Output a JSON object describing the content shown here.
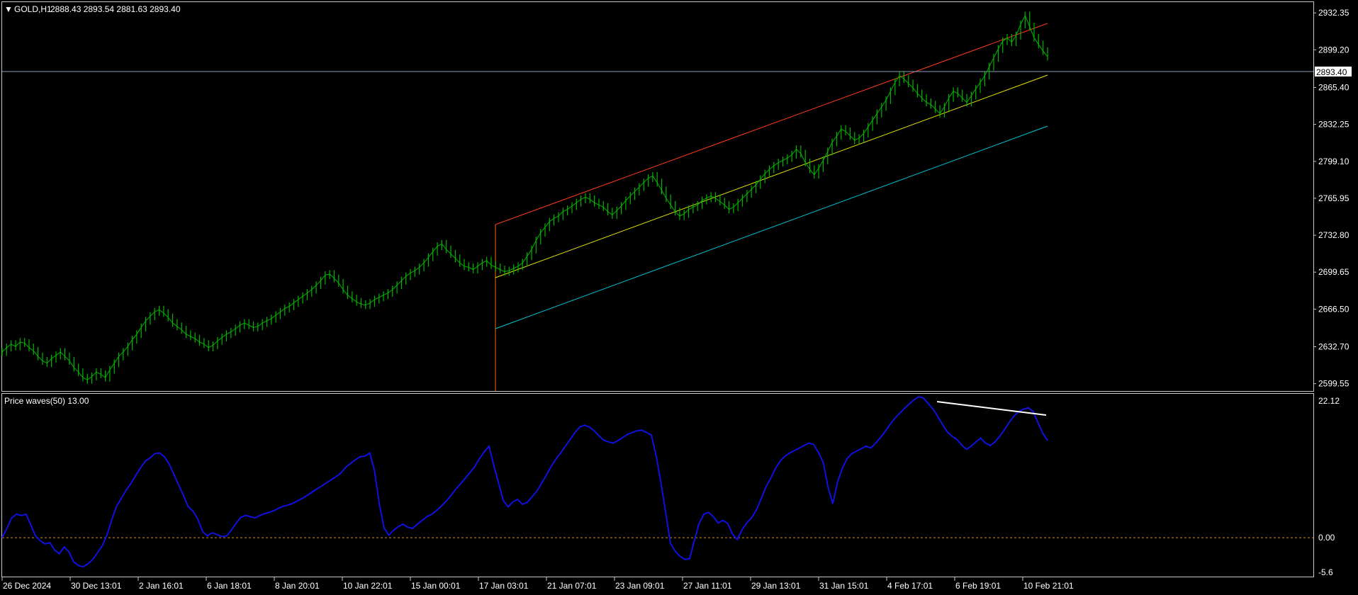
{
  "window": {
    "symbol_label": "GOLD,H1",
    "ohlc": "2888.43 2893.54 2881.63 2893.40",
    "indicator_label": "Price waves(50) 13.00"
  },
  "price_axis": {
    "ticks": [
      "2932.35",
      "2899.20",
      "2865.40",
      "2832.25",
      "2799.10",
      "2765.95",
      "2732.80",
      "2699.65",
      "2666.50",
      "2632.70",
      "2599.55"
    ],
    "current_price": "2893.40"
  },
  "indicator_axis": {
    "ticks": [
      "22.12",
      "0.00",
      "-5.6"
    ]
  },
  "time_axis": {
    "ticks": [
      "26 Dec 2024",
      "30 Dec 13:01",
      "2 Jan 16:01",
      "6 Jan 18:01",
      "8 Jan 20:01",
      "10 Jan 22:01",
      "15 Jan 00:01",
      "17 Jan 03:01",
      "21 Jan 07:01",
      "23 Jan 09:01",
      "27 Jan 11:01",
      "29 Jan 13:01",
      "31 Jan 15:01",
      "4 Feb 17:01",
      "6 Feb 19:01",
      "10 Feb 21:01"
    ]
  },
  "colors": {
    "background": "#000000",
    "border": "#c8c8c8",
    "price_series": "#00b400",
    "indicator_series": "#1010e0",
    "channel_upper": "#ff3a1a",
    "channel_middle": "#e8e800",
    "channel_lower": "#00c8d8",
    "channel_start_line": "#ff6a00",
    "current_price_line": "#8ca0b8",
    "zero_line": "#d89020",
    "divergence_line": "#ffffff"
  },
  "chart_data": [
    {
      "type": "line",
      "series": [
        {
          "values": [
            2628,
            2632,
            2635,
            2633,
            2637,
            2636,
            2632,
            2629,
            2624,
            2620,
            2618,
            2622,
            2625,
            2628,
            2624,
            2620,
            2614,
            2610,
            2605,
            2603,
            2606,
            2610,
            2608,
            2605,
            2612,
            2618,
            2624,
            2628,
            2633,
            2639,
            2644,
            2650,
            2656,
            2660,
            2664,
            2666,
            2663,
            2659,
            2654,
            2651,
            2648,
            2644,
            2642,
            2640,
            2637,
            2635,
            2632,
            2634,
            2638,
            2641,
            2644,
            2646,
            2649,
            2652,
            2654,
            2652,
            2650,
            2651,
            2654,
            2656,
            2658,
            2661,
            2664,
            2667,
            2669,
            2672,
            2675,
            2678,
            2681,
            2684,
            2688,
            2692,
            2697,
            2698,
            2694,
            2690,
            2684,
            2679,
            2676,
            2673,
            2671,
            2670,
            2672,
            2675,
            2677,
            2679,
            2681,
            2684,
            2688,
            2692,
            2696,
            2699,
            2701,
            2704,
            2708,
            2713,
            2718,
            2723,
            2725,
            2720,
            2716,
            2712,
            2708,
            2705,
            2704,
            2702,
            2705,
            2708,
            2710,
            2706,
            2704,
            2702,
            2700,
            2701,
            2703,
            2705,
            2708,
            2714,
            2720,
            2728,
            2735,
            2740,
            2745,
            2748,
            2750,
            2754,
            2756,
            2759,
            2762,
            2765,
            2767,
            2765,
            2762,
            2760,
            2758,
            2754,
            2751,
            2755,
            2759,
            2764,
            2768,
            2772,
            2776,
            2780,
            2784,
            2786,
            2780,
            2773,
            2766,
            2760,
            2754,
            2750,
            2752,
            2756,
            2758,
            2760,
            2764,
            2766,
            2768,
            2766,
            2763,
            2760,
            2756,
            2758,
            2762,
            2766,
            2770,
            2774,
            2778,
            2783,
            2788,
            2792,
            2795,
            2798,
            2800,
            2802,
            2805,
            2810,
            2806,
            2798,
            2792,
            2787,
            2793,
            2800,
            2808,
            2816,
            2822,
            2828,
            2826,
            2822,
            2818,
            2820,
            2824,
            2830,
            2836,
            2842,
            2848,
            2854,
            2862,
            2870,
            2876,
            2873,
            2869,
            2865,
            2860,
            2856,
            2852,
            2850,
            2846,
            2842,
            2848,
            2856,
            2862,
            2860,
            2856,
            2852,
            2858,
            2864,
            2870,
            2876,
            2884,
            2892,
            2900,
            2907,
            2910,
            2906,
            2912,
            2922,
            2930,
            2920,
            2910,
            2904,
            2898,
            2893
          ]
        }
      ],
      "ylim": [
        2593,
        2942
      ]
    },
    {
      "type": "line",
      "series": [
        {
          "values": [
            0.0,
            1.5,
            3.2,
            3.8,
            3.6,
            3.8,
            2.1,
            0.3,
            -0.5,
            -1.0,
            -0.8,
            -2.0,
            -2.6,
            -1.5,
            -2.3,
            -3.9,
            -4.5,
            -4.7,
            -4.2,
            -3.5,
            -2.4,
            -1.3,
            0.5,
            3.0,
            5.1,
            6.4,
            7.7,
            8.8,
            10.1,
            11.3,
            12.4,
            12.9,
            13.6,
            13.7,
            13.1,
            11.9,
            10.2,
            8.5,
            6.8,
            5.0,
            4.3,
            3.0,
            1.0,
            0.3,
            0.8,
            0.5,
            0.2,
            0.3,
            1.2,
            2.3,
            3.3,
            3.6,
            3.4,
            3.2,
            3.6,
            3.9,
            4.1,
            4.4,
            4.8,
            5.1,
            5.3,
            5.6,
            6.0,
            6.4,
            6.9,
            7.4,
            7.9,
            8.4,
            8.9,
            9.4,
            9.9,
            10.5,
            11.4,
            12.0,
            12.6,
            13.1,
            13.2,
            13.7,
            10.9,
            5.5,
            1.6,
            0.4,
            1.2,
            1.8,
            2.2,
            1.7,
            1.5,
            2.2,
            2.8,
            3.4,
            3.8,
            4.4,
            5.1,
            5.9,
            6.8,
            7.8,
            8.7,
            9.6,
            10.5,
            11.5,
            12.8,
            13.9,
            14.8,
            11.7,
            8.8,
            6.0,
            5.0,
            5.8,
            6.2,
            5.4,
            5.7,
            6.6,
            7.5,
            8.8,
            10.1,
            11.5,
            12.7,
            13.7,
            14.8,
            15.9,
            17.0,
            17.9,
            18.2,
            17.9,
            17.3,
            16.5,
            15.8,
            15.5,
            15.3,
            15.7,
            16.2,
            16.7,
            17.0,
            17.3,
            17.4,
            17.0,
            16.6,
            13.3,
            8.9,
            4.1,
            -0.9,
            -2.2,
            -3.0,
            -3.5,
            -3.4,
            -0.5,
            2.3,
            3.8,
            4.1,
            3.4,
            2.4,
            2.8,
            2.3,
            0.6,
            -0.3,
            1.3,
            2.4,
            3.2,
            4.5,
            6.3,
            8.2,
            9.6,
            11.2,
            12.4,
            13.2,
            13.7,
            14.1,
            14.5,
            14.9,
            15.3,
            15.1,
            13.8,
            12.2,
            8.2,
            5.5,
            9.0,
            11.2,
            12.8,
            13.6,
            14.0,
            14.4,
            14.8,
            14.5,
            15.3,
            16.2,
            17.2,
            18.3,
            19.3,
            20.1,
            20.9,
            21.6,
            22.3,
            22.8,
            22.6,
            21.7,
            20.8,
            19.6,
            18.3,
            17.1,
            16.4,
            15.9,
            15.0,
            14.3,
            14.8,
            15.5,
            16.1,
            15.3,
            14.9,
            15.5,
            16.4,
            17.5,
            18.7,
            19.7,
            20.4,
            20.8,
            21.0,
            20.4,
            18.6,
            16.9,
            15.7
          ]
        }
      ],
      "ylim": [
        -5.6,
        22.12
      ]
    }
  ]
}
